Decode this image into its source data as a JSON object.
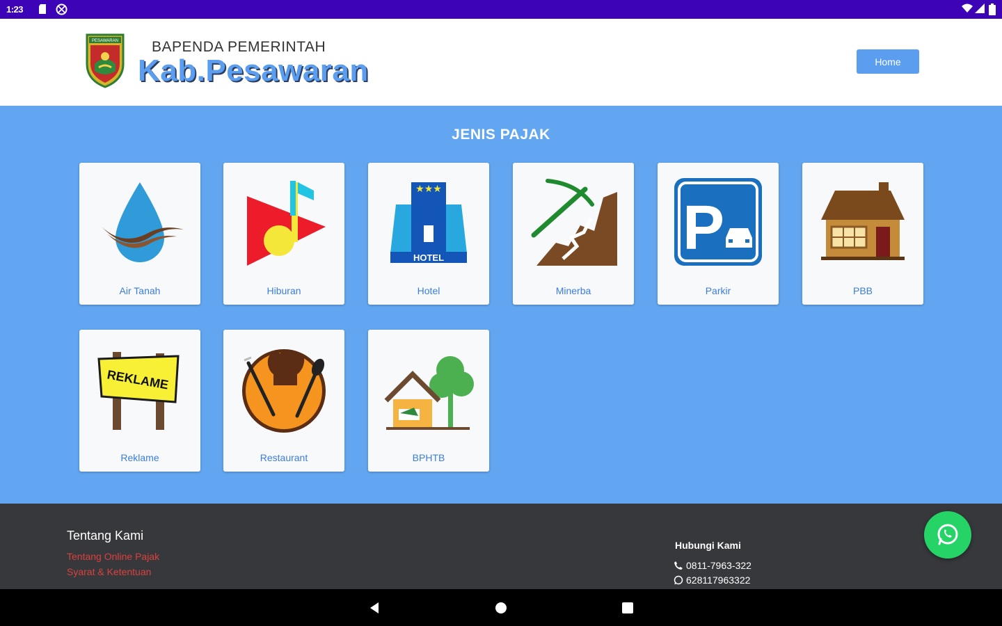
{
  "status_bar": {
    "time": "1:23"
  },
  "header": {
    "org_subtitle": "BAPENDA PEMERINTAH",
    "org_title": "Kab.Pesawaran",
    "logo_text": "PESAWARAN",
    "home_button": "Home"
  },
  "main": {
    "section_title": "JENIS PAJAK",
    "tiles": [
      {
        "label": "Air Tanah",
        "icon": "water-drop-icon"
      },
      {
        "label": "Hiburan",
        "icon": "music-play-icon"
      },
      {
        "label": "Hotel",
        "icon": "hotel-building-icon",
        "sign": "HOTEL"
      },
      {
        "label": "Minerba",
        "icon": "mining-pickaxe-icon"
      },
      {
        "label": "Parkir",
        "icon": "parking-sign-icon",
        "sign": "P"
      },
      {
        "label": "PBB",
        "icon": "house-icon"
      },
      {
        "label": "Reklame",
        "icon": "billboard-sign-icon",
        "sign": "REKLAME"
      },
      {
        "label": "Restaurant",
        "icon": "restaurant-icon"
      },
      {
        "label": "BPHTB",
        "icon": "land-house-tree-icon"
      }
    ]
  },
  "footer": {
    "about_title": "Tentang Kami",
    "links": [
      "Tentang Online Pajak",
      "Syarat & Ketentuan"
    ],
    "contact_title": "Hubungi Kami",
    "phone": "0811-7963-322",
    "whatsapp": "628117963322"
  },
  "colors": {
    "status_bar": "#3d04b7",
    "accent": "#5b9ef0",
    "main_bg": "#62a5f0",
    "footer_bg": "#37383c",
    "link_red": "#d9413c",
    "whatsapp_green": "#25d366"
  }
}
